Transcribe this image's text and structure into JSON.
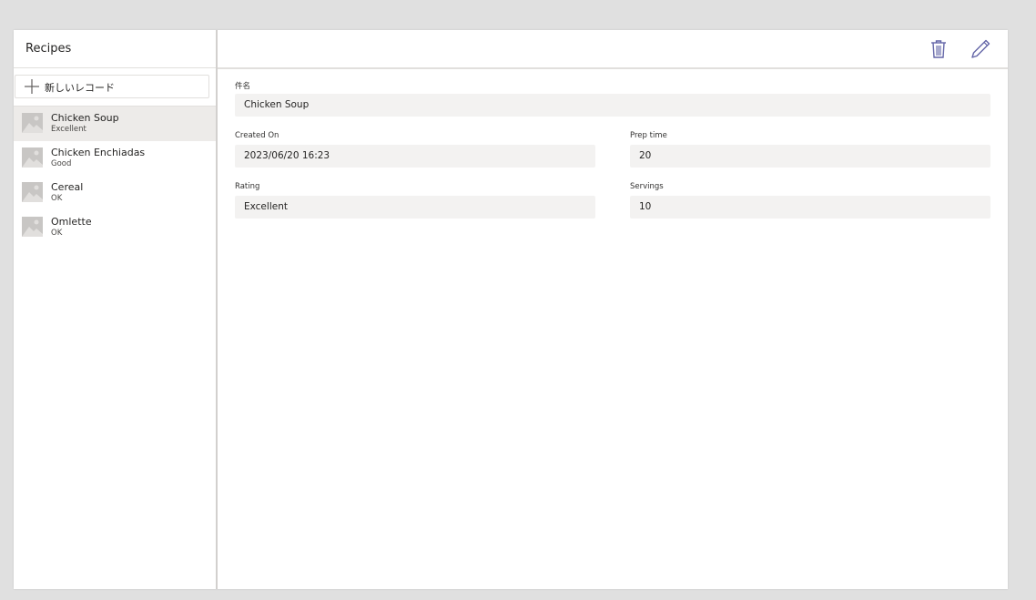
{
  "left_panel": {
    "title": "Recipes",
    "new_record_label": "新しいレコード",
    "items": [
      {
        "title": "Chicken Soup",
        "subtitle": "Excellent",
        "selected": true
      },
      {
        "title": "Chicken Enchiadas",
        "subtitle": "Good",
        "selected": false
      },
      {
        "title": "Cereal",
        "subtitle": "OK",
        "selected": false
      },
      {
        "title": "Omlette",
        "subtitle": "OK",
        "selected": false
      }
    ]
  },
  "toolbar": {
    "delete_icon": "trash-icon",
    "edit_icon": "pencil-icon"
  },
  "form": {
    "name": {
      "label": "件名",
      "value": "Chicken Soup"
    },
    "created_on": {
      "label": "Created On",
      "value": "2023/06/20 16:23"
    },
    "prep_time": {
      "label": "Prep time",
      "value": "20"
    },
    "rating": {
      "label": "Rating",
      "value": "Excellent"
    },
    "servings": {
      "label": "Servings",
      "value": "10"
    }
  },
  "colors": {
    "accent": "#6264a7",
    "selected_row": "#edebe9",
    "field_background": "#f3f2f1",
    "page_background": "#e0e0e0"
  }
}
